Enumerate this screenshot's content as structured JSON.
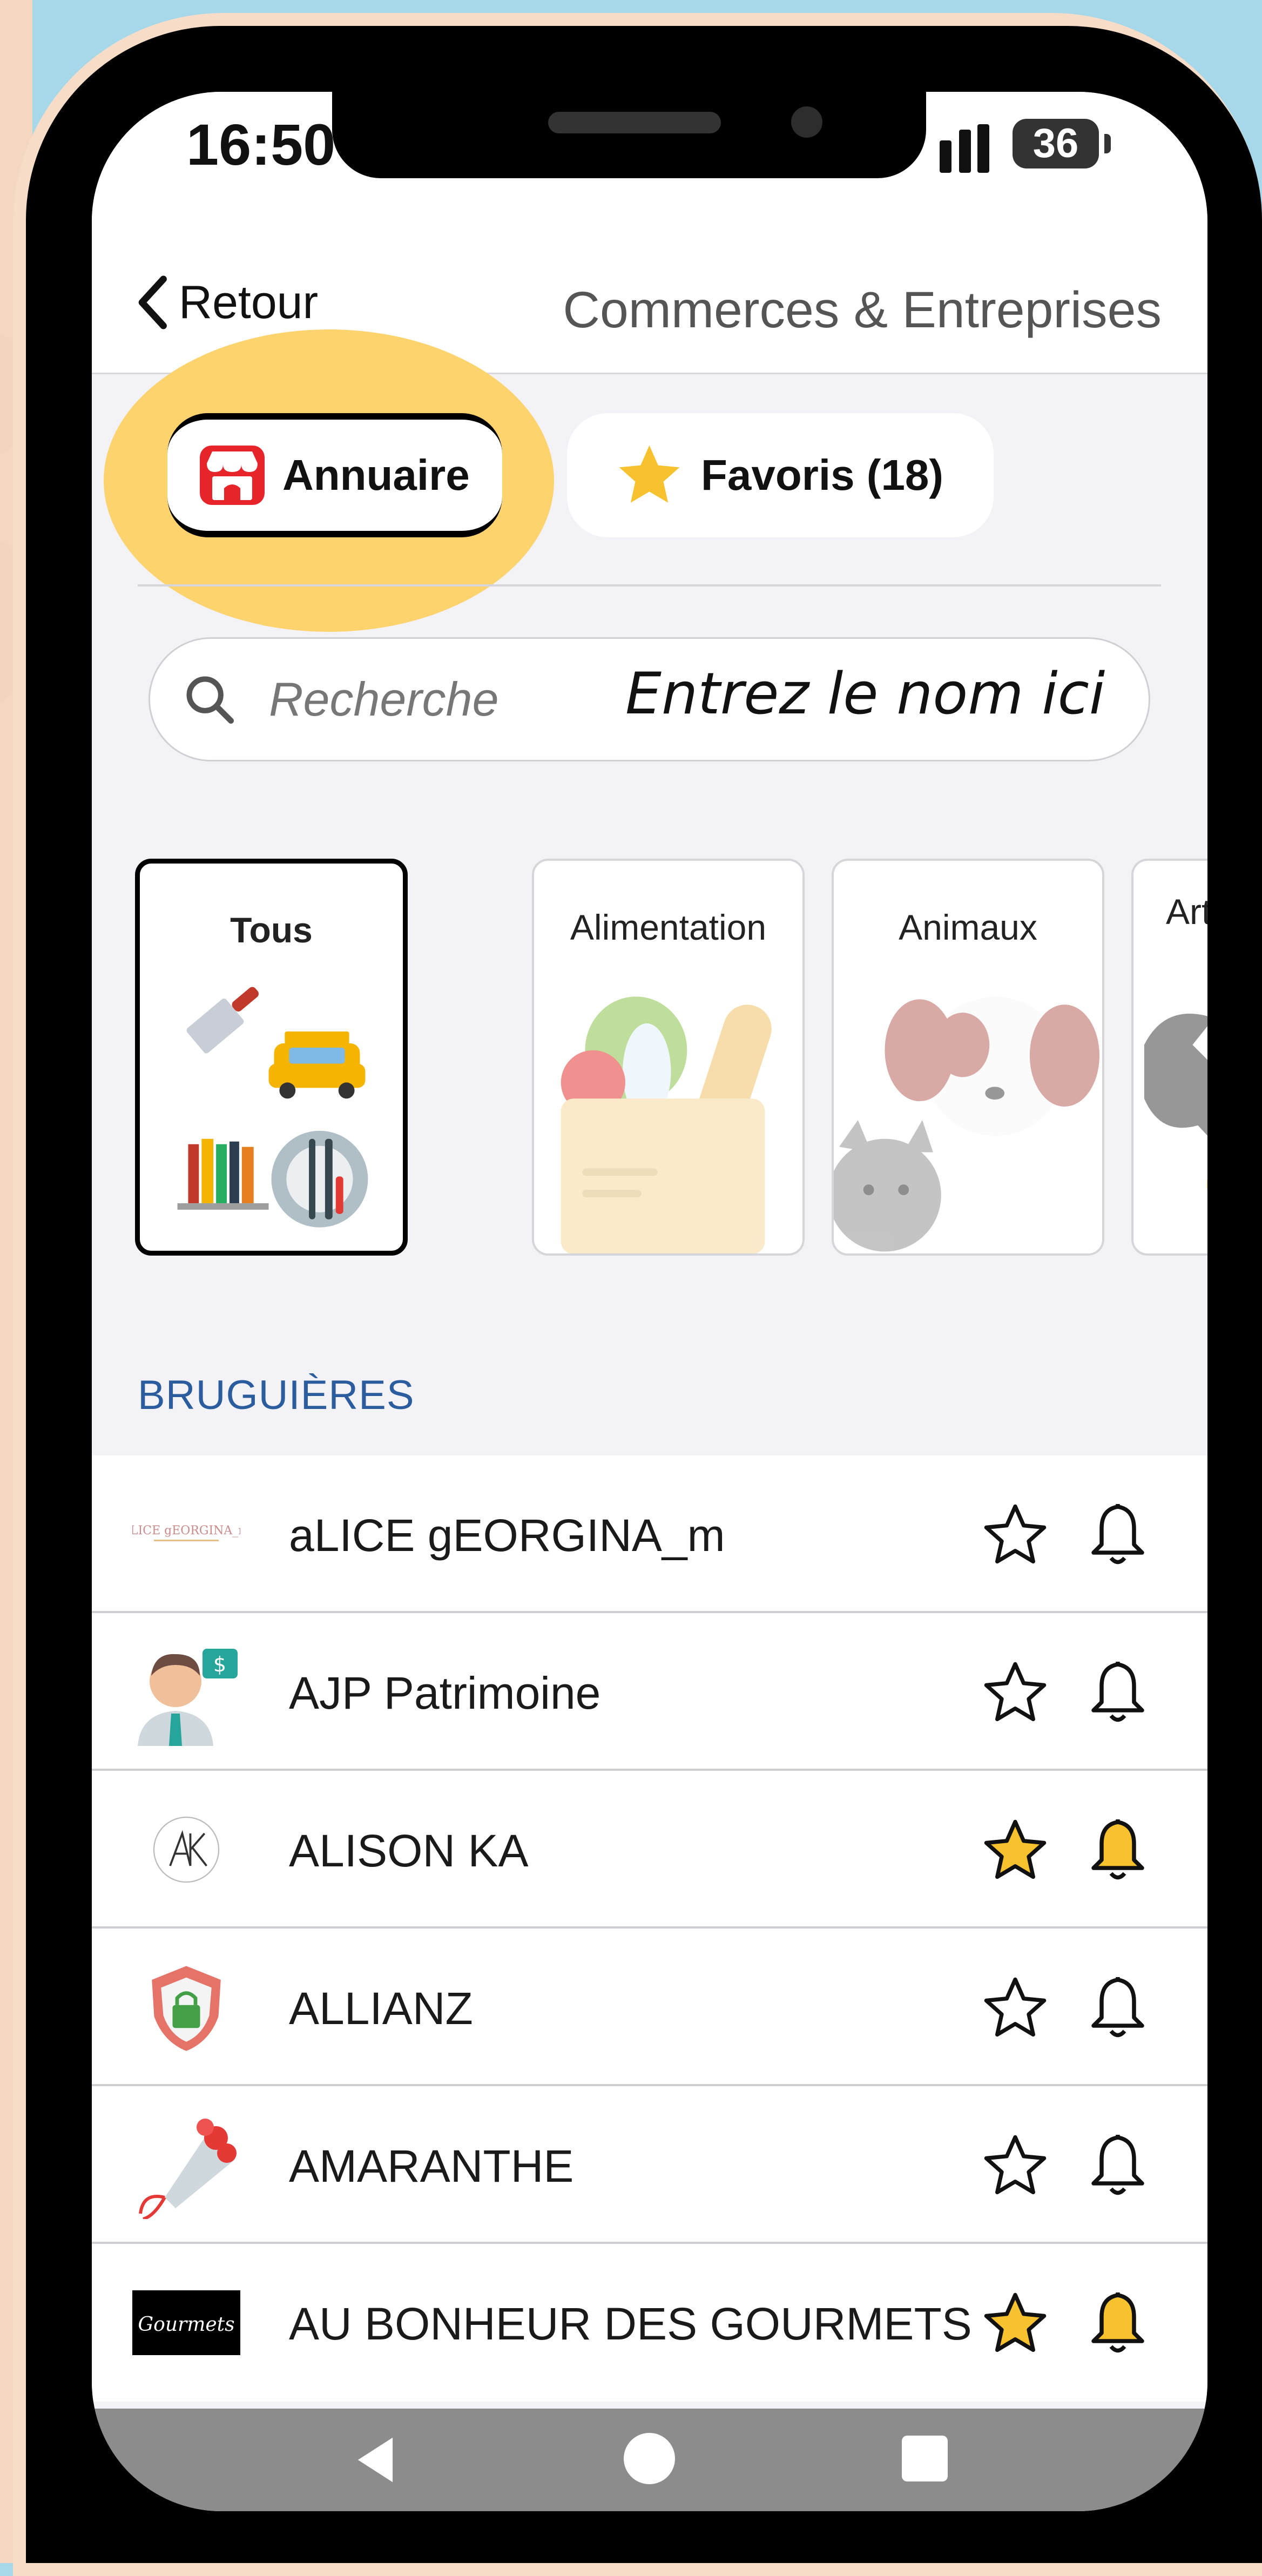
{
  "status_bar": {
    "time": "16:50",
    "battery": "36"
  },
  "header": {
    "back_label": "Retour",
    "title": "Commerces & Entreprises"
  },
  "tabs": [
    {
      "label": "Annuaire",
      "active": true
    },
    {
      "label": "Favoris (18)",
      "active": false
    }
  ],
  "search": {
    "placeholder": "Recherche",
    "hint": "Entrez le nom ici"
  },
  "categories": [
    {
      "label": "Tous",
      "selected": true
    },
    {
      "label": "Alimentation",
      "selected": false
    },
    {
      "label": "Animaux",
      "selected": false
    },
    {
      "label": "Artisan BTP",
      "selected": false
    }
  ],
  "section": {
    "title": "BRUGUIÈRES"
  },
  "businesses": [
    {
      "name": "aLICE gEORGINA_m",
      "favorite": false,
      "logo": "alice-georgina-logo"
    },
    {
      "name": "AJP Patrimoine",
      "favorite": false,
      "logo": "advisor-avatar-icon"
    },
    {
      "name": "ALISON KA",
      "favorite": true,
      "logo": "ak-monogram-logo"
    },
    {
      "name": "ALLIANZ",
      "favorite": false,
      "logo": "shield-lock-icon"
    },
    {
      "name": "AMARANTHE",
      "favorite": false,
      "logo": "flower-bouquet-icon"
    },
    {
      "name": "AU BONHEUR DES GOURMETS",
      "favorite": true,
      "logo": "gourmets-logo"
    }
  ],
  "colors": {
    "accent_highlight": "#fdd36e",
    "favorite_yellow": "#f7c22d",
    "section_blue": "#2b5c9e",
    "store_red": "#e8242b"
  }
}
